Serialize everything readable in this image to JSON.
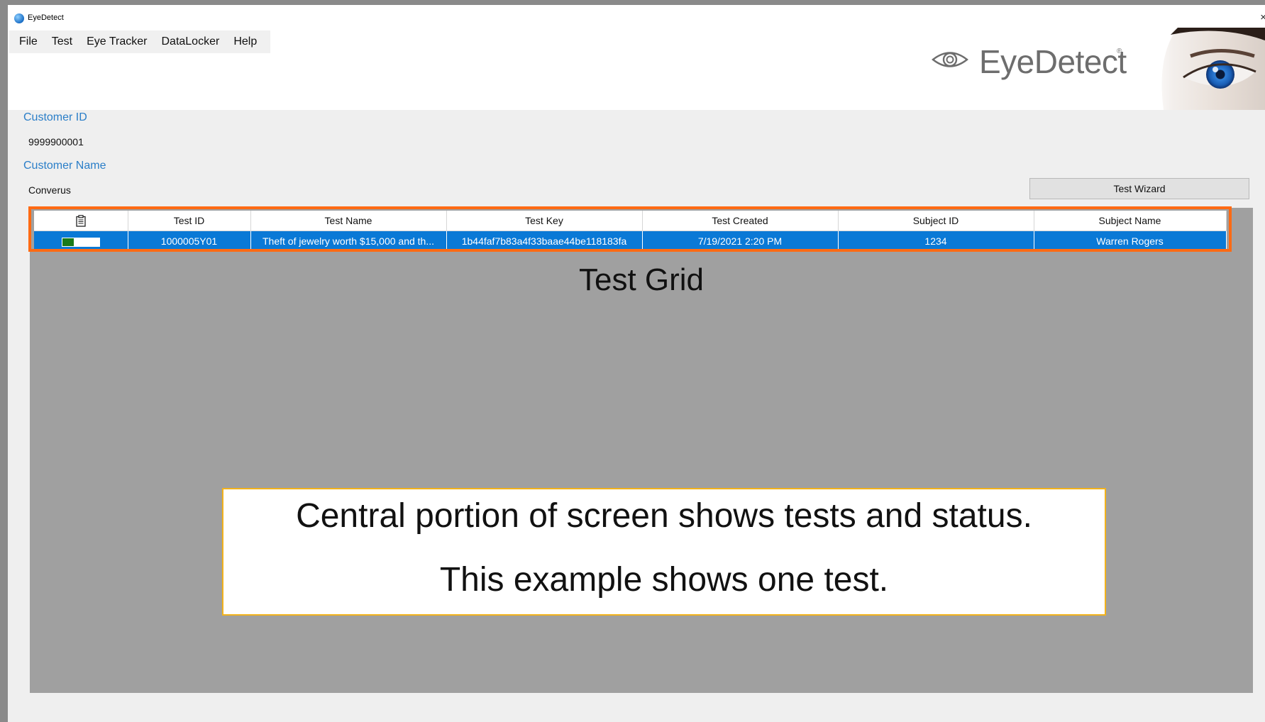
{
  "window": {
    "title": "EyeDetect",
    "close_glyph": "×"
  },
  "menu": [
    {
      "label": "File"
    },
    {
      "label": "Test"
    },
    {
      "label": "Eye Tracker"
    },
    {
      "label": "DataLocker"
    },
    {
      "label": "Help"
    }
  ],
  "logo": {
    "text": "EyeDetect",
    "reg": "®",
    "icon": "eye-logo-icon"
  },
  "customer": {
    "id_label": "Customer ID",
    "id_value": "9999900001",
    "name_label": "Customer Name",
    "name_value": "Converus"
  },
  "toolbar": {
    "wizard_label": "Test Wizard"
  },
  "grid": {
    "columns": [
      "",
      "Test ID",
      "Test Name",
      "Test Key",
      "Test Created",
      "Subject ID",
      "Subject Name"
    ],
    "rows": [
      {
        "status": [
          "complete",
          "pending",
          "pending"
        ],
        "test_id": "1000005Y01",
        "test_name": "Theft of jewelry worth $15,000 and th...",
        "test_key": "1b44faf7b83a4f33baae44be118183fa",
        "test_created": "7/19/2021 2:20 PM",
        "subject_id": "1234",
        "subject_name": "Warren Rogers"
      }
    ]
  },
  "annotations": {
    "grid_caption": "Test Grid",
    "callout_line1": "Central portion of screen shows tests and status.",
    "callout_line2": "This example shows one test."
  },
  "colors": {
    "accent_blue": "#2a7ec8",
    "selected_row": "#0a79d6",
    "highlight_orange": "#ff6a13",
    "callout_border": "#f2b21b",
    "status_complete": "#1a7a1a"
  }
}
